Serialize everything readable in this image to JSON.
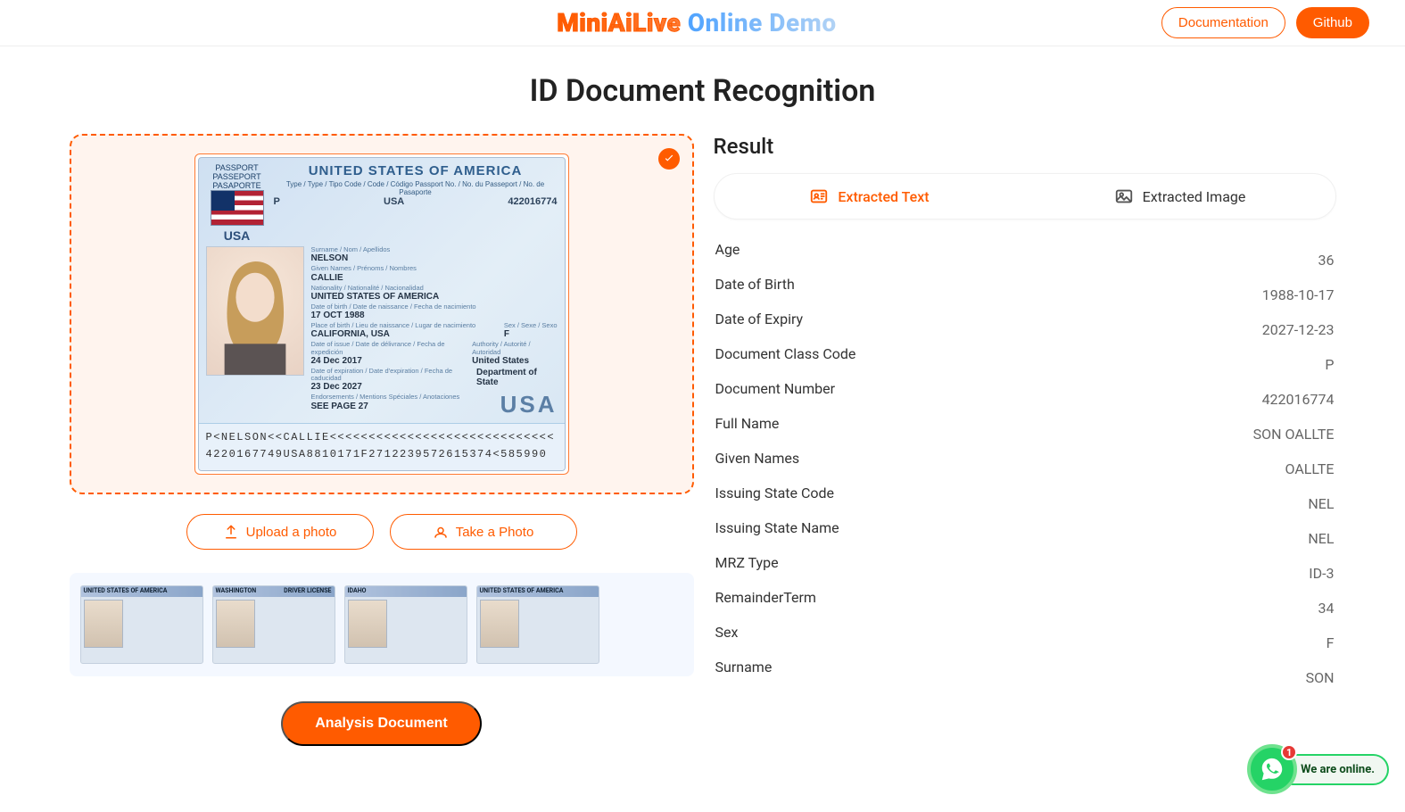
{
  "header": {
    "logo_a": "MiniAiLive",
    "logo_b": "Online Demo",
    "documentation": "Documentation",
    "github": "Github"
  },
  "page_title": "ID Document Recognition",
  "passport": {
    "label1": "PASSPORT",
    "label2": "PASSEPORT",
    "label3": "PASAPORTE",
    "usa_badge": "USA",
    "country_line": "UNITED STATES OF AMERICA",
    "row_labels": "Type / Type / Tipo   Code / Code / Código   Passport No. / No. du Passeport / No. de Pasaporte",
    "type": "P",
    "code": "USA",
    "number": "422016774",
    "surname_label": "Surname / Nom / Apellidos",
    "surname": "NELSON",
    "given_label": "Given Names / Prénoms / Nombres",
    "given": "CALLIE",
    "nat_label": "Nationality / Nationalité / Nacionalidad",
    "nat": "UNITED STATES OF AMERICA",
    "dob_label": "Date of birth / Date de naissance / Fecha de nacimiento",
    "dob": "17 OCT 1988",
    "pob_label": "Place of birth / Lieu de naissance / Lugar de nacimiento",
    "pob": "CALIFORNIA, USA",
    "doi_label": "Date of issue / Date de délivrance / Fecha de expedición",
    "doi": "24 Dec 2017",
    "doe_label": "Date of expiration / Date d'expiration / Fecha de caducidad",
    "doe": "23 Dec 2027",
    "end_label": "Endorsements / Mentions Spéciales / Anotaciones",
    "end": "SEE PAGE 27",
    "sex_label": "Sex / Sexe / Sexo",
    "sex": "F",
    "auth_label": "Authority / Autorité / Autoridad",
    "auth1": "United States",
    "auth2": "Department of State",
    "big_usa": "USA",
    "mrz1": "P<NELSON<<CALLIE<<<<<<<<<<<<<<<<<<<<<<<<<<<<<",
    "mrz2": "4220167749USA8810171F2712239572615374<585990"
  },
  "buttons": {
    "upload": "Upload a photo",
    "take": "Take a Photo",
    "analyze": "Analysis Document"
  },
  "thumbs": {
    "t1": "UNITED STATES OF AMERICA",
    "t2a": "WASHINGTON",
    "t2b": "DRIVER LICENSE",
    "t3": "IDAHO",
    "t4": "UNITED STATES OF AMERICA"
  },
  "result": {
    "title": "Result",
    "tab_text": "Extracted Text",
    "tab_image": "Extracted Image",
    "fields": [
      {
        "k": "Age",
        "v": "36"
      },
      {
        "k": "Date of Birth",
        "v": "1988-10-17"
      },
      {
        "k": "Date of Expiry",
        "v": "2027-12-23"
      },
      {
        "k": "Document Class Code",
        "v": "P"
      },
      {
        "k": "Document Number",
        "v": "422016774"
      },
      {
        "k": "Full Name",
        "v": "SON OALLTE"
      },
      {
        "k": "Given Names",
        "v": "OALLTE"
      },
      {
        "k": "Issuing State Code",
        "v": "NEL"
      },
      {
        "k": "Issuing State Name",
        "v": "NEL"
      },
      {
        "k": "MRZ Type",
        "v": "ID-3"
      },
      {
        "k": "RemainderTerm",
        "v": "34"
      },
      {
        "k": "Sex",
        "v": "F"
      },
      {
        "k": "Surname",
        "v": "SON"
      }
    ]
  },
  "whatsapp": {
    "badge": "1",
    "label": "We are online."
  }
}
